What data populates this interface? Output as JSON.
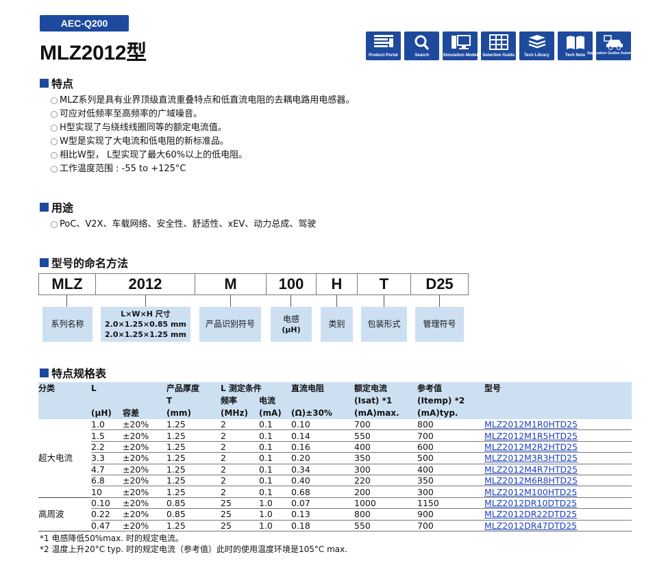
{
  "header": {
    "badge": "AEC-Q200",
    "title": "MLZ2012型"
  },
  "toolbar": {
    "buttons": [
      {
        "label": "Product Portal",
        "icon": "product-portal-icon"
      },
      {
        "label": "Search",
        "icon": "search-icon"
      },
      {
        "label": "Simulation Model",
        "icon": "simulation-model-icon"
      },
      {
        "label": "Selection Guide",
        "icon": "selection-guide-icon"
      },
      {
        "label": "Tech Library",
        "icon": "tech-library-icon"
      },
      {
        "label": "Tech Note",
        "icon": "tech-note-icon"
      },
      {
        "label": "Application Guides Automotive",
        "icon": "automotive-guide-icon"
      }
    ]
  },
  "features": {
    "heading": "特点",
    "items": [
      "MLZ系列是具有业界顶级直流重叠特点和低直流电阻的去耦电路用电感器。",
      "可应对低频率至高频率的广域噪音。",
      "H型实现了与绕线线圈同等的额定电流值。",
      "W型是实现了大电流和低电阻的新标准品。",
      "相比W型， L型实现了最大60%以上的低电阻。",
      "工作温度范围 : -55 to +125°C"
    ]
  },
  "applications": {
    "heading": "用途",
    "items": [
      "PoC、V2X、车载网络、安全性、舒适性、xEV、动力总成、驾驶"
    ]
  },
  "naming": {
    "heading": "型号的命名方法",
    "codes": [
      "MLZ",
      "2012",
      "M",
      "100",
      "H",
      "T",
      "D25"
    ],
    "labels": {
      "series": "系列名称",
      "size_title": "L×W×H 尺寸",
      "size_1": "2.0×1.25×0.85 mm",
      "size_2": "2.0×1.25×1.25 mm",
      "product_id": "产品识别符号",
      "inductance": "电感",
      "inductance_unit": "(μH)",
      "category": "类别",
      "packaging": "包装形式",
      "management": "管理符号"
    }
  },
  "spec": {
    "heading": "特点规格表",
    "headers": {
      "category": "分类",
      "l": "L",
      "l_unit": "(μH)",
      "tolerance": "容差",
      "thickness": "产品厚度",
      "thickness_t": "T",
      "thickness_unit": "(mm)",
      "test_cond": "L 测定条件",
      "freq": "频率",
      "freq_unit": "(MHz)",
      "current": "电流",
      "current_unit": "(mA)",
      "dcr": "直流电阻",
      "dcr_unit": "(Ω)±30%",
      "rated": "额定电流",
      "rated_sub": "(Isat) *1",
      "rated_unit": "(mA)max.",
      "ref": "参考值",
      "ref_sub": "(Itemp) *2",
      "ref_unit": "(mA)typ.",
      "part": "型号"
    },
    "groups": [
      {
        "name": "超大电流",
        "rows": [
          [
            "1.0",
            "±20%",
            "1.25",
            "2",
            "0.1",
            "0.10",
            "700",
            "800",
            "MLZ2012M1R0HTD25"
          ],
          [
            "1.5",
            "±20%",
            "1.25",
            "2",
            "0.1",
            "0.14",
            "550",
            "700",
            "MLZ2012M1R5HTD25"
          ],
          [
            "2.2",
            "±20%",
            "1.25",
            "2",
            "0.1",
            "0.16",
            "400",
            "600",
            "MLZ2012M2R2HTD25"
          ],
          [
            "3.3",
            "±20%",
            "1.25",
            "2",
            "0.1",
            "0.20",
            "350",
            "500",
            "MLZ2012M3R3HTD25"
          ],
          [
            "4.7",
            "±20%",
            "1.25",
            "2",
            "0.1",
            "0.34",
            "300",
            "400",
            "MLZ2012M4R7HTD25"
          ],
          [
            "6.8",
            "±20%",
            "1.25",
            "2",
            "0.1",
            "0.40",
            "220",
            "350",
            "MLZ2012M6R8HTD25"
          ],
          [
            "10",
            "±20%",
            "1.25",
            "2",
            "0.1",
            "0.68",
            "200",
            "300",
            "MLZ2012M100HTD25"
          ]
        ]
      },
      {
        "name": "高周波",
        "rows": [
          [
            "0.10",
            "±20%",
            "0.85",
            "25",
            "1.0",
            "0.07",
            "1000",
            "1150",
            "MLZ2012DR10DTD25"
          ],
          [
            "0.22",
            "±20%",
            "0.85",
            "25",
            "1.0",
            "0.13",
            "800",
            "900",
            "MLZ2012DR22DTD25"
          ],
          [
            "0.47",
            "±20%",
            "1.25",
            "25",
            "1.0",
            "0.18",
            "550",
            "700",
            "MLZ2012DR47DTD25"
          ]
        ]
      }
    ],
    "notes": [
      "*1 电感降低50%max. 时的规定电流。",
      "*2 温度上升20°C typ. 时的规定电流（参考值）此时的使用温度环境是105°C max."
    ]
  },
  "colors": {
    "brand": "#1e4a9e",
    "light_blue": "#cce0f2",
    "link": "#1a3fbf"
  }
}
